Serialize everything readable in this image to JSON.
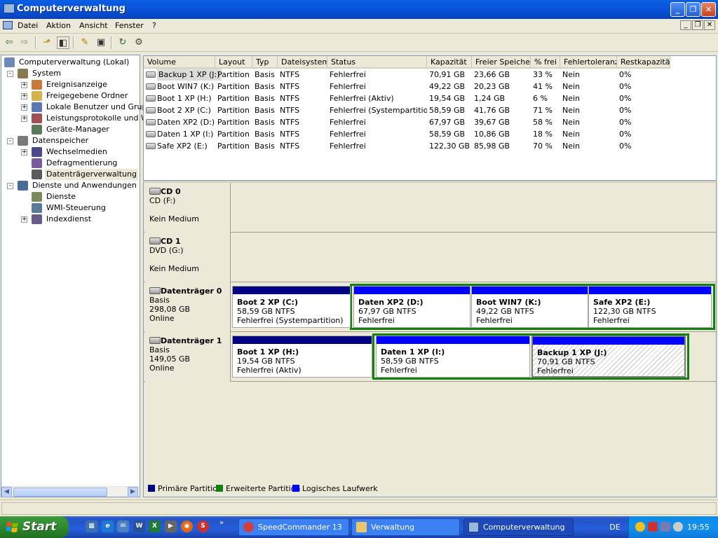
{
  "window": {
    "title": "Computerverwaltung"
  },
  "menu": [
    "Datei",
    "Aktion",
    "Ansicht",
    "Fenster",
    "?"
  ],
  "tree": [
    {
      "label": "Computerverwaltung (Lokal)",
      "level": 0,
      "expander": "",
      "icon": "computer-icon"
    },
    {
      "label": "System",
      "level": 1,
      "expander": "−",
      "icon": "tools-icon"
    },
    {
      "label": "Ereignisanzeige",
      "level": 2,
      "expander": "+",
      "icon": "event-viewer-icon"
    },
    {
      "label": "Freigegebene Ordner",
      "level": 2,
      "expander": "+",
      "icon": "shared-folder-icon"
    },
    {
      "label": "Lokale Benutzer und Gruppe",
      "level": 2,
      "expander": "+",
      "icon": "users-icon"
    },
    {
      "label": "Leistungsprotokolle und War",
      "level": 2,
      "expander": "+",
      "icon": "performance-icon"
    },
    {
      "label": "Geräte-Manager",
      "level": 2,
      "expander": "",
      "icon": "device-manager-icon"
    },
    {
      "label": "Datenspeicher",
      "level": 1,
      "expander": "−",
      "icon": "storage-icon"
    },
    {
      "label": "Wechselmedien",
      "level": 2,
      "expander": "+",
      "icon": "removable-media-icon"
    },
    {
      "label": "Defragmentierung",
      "level": 2,
      "expander": "",
      "icon": "defrag-icon"
    },
    {
      "label": "Datenträgerverwaltung",
      "level": 2,
      "expander": "",
      "icon": "disk-management-icon",
      "selected": true
    },
    {
      "label": "Dienste und Anwendungen",
      "level": 1,
      "expander": "−",
      "icon": "services-apps-icon"
    },
    {
      "label": "Dienste",
      "level": 2,
      "expander": "",
      "icon": "services-icon"
    },
    {
      "label": "WMI-Steuerung",
      "level": 2,
      "expander": "",
      "icon": "wmi-icon"
    },
    {
      "label": "Indexdienst",
      "level": 2,
      "expander": "+",
      "icon": "indexing-icon"
    }
  ],
  "volume_list": {
    "columns": [
      "Volume",
      "Layout",
      "Typ",
      "Dateisystem",
      "Status",
      "Kapazität",
      "Freier Speicher",
      "% frei",
      "Fehlertoleranz",
      "Restkapazität"
    ],
    "rows": [
      [
        "Backup 1 XP (J:)",
        "Partition",
        "Basis",
        "NTFS",
        "Fehlerfrei",
        "70,91 GB",
        "23,66 GB",
        "33 %",
        "Nein",
        "0%"
      ],
      [
        "Boot WIN7 (K:)",
        "Partition",
        "Basis",
        "NTFS",
        "Fehlerfrei",
        "49,22 GB",
        "20,23 GB",
        "41 %",
        "Nein",
        "0%"
      ],
      [
        "Boot 1 XP (H:)",
        "Partition",
        "Basis",
        "NTFS",
        "Fehlerfrei (Aktiv)",
        "19,54 GB",
        "1,24 GB",
        "6 %",
        "Nein",
        "0%"
      ],
      [
        "Boot 2 XP (C:)",
        "Partition",
        "Basis",
        "NTFS",
        "Fehlerfrei (Systempartition)",
        "58,59 GB",
        "41,76 GB",
        "71 %",
        "Nein",
        "0%"
      ],
      [
        "Daten XP2 (D:)",
        "Partition",
        "Basis",
        "NTFS",
        "Fehlerfrei",
        "67,97 GB",
        "39,67 GB",
        "58 %",
        "Nein",
        "0%"
      ],
      [
        "Daten 1 XP (I:)",
        "Partition",
        "Basis",
        "NTFS",
        "Fehlerfrei",
        "58,59 GB",
        "10,86 GB",
        "18 %",
        "Nein",
        "0%"
      ],
      [
        "Safe XP2 (E:)",
        "Partition",
        "Basis",
        "NTFS",
        "Fehlerfrei",
        "122,30 GB",
        "85,98 GB",
        "70 %",
        "Nein",
        "0%"
      ]
    ]
  },
  "disks": [
    {
      "name": "CD 0",
      "line1": "CD (F:)",
      "line3": "Kein Medium"
    },
    {
      "name": "CD 1",
      "line1": "DVD (G:)",
      "line3": "Kein Medium"
    },
    {
      "name": "Datenträger 0",
      "line1": "Basis",
      "line2": "298,08 GB",
      "line3": "Online",
      "partitions": [
        {
          "title": "Boot 2 XP  (C:)",
          "size": "58,59 GB NTFS",
          "status": "Fehlerfrei (Systempartition)",
          "kind": "primary"
        },
        {
          "title": "Daten XP2  (D:)",
          "size": "67,97 GB NTFS",
          "status": "Fehlerfrei",
          "kind": "logical"
        },
        {
          "title": "Boot WIN7  (K:)",
          "size": "49,22 GB NTFS",
          "status": "Fehlerfrei",
          "kind": "logical"
        },
        {
          "title": "Safe XP2  (E:)",
          "size": "122,30 GB NTFS",
          "status": "Fehlerfrei",
          "kind": "logical"
        }
      ]
    },
    {
      "name": "Datenträger 1",
      "line1": "Basis",
      "line2": "149,05 GB",
      "line3": "Online",
      "partitions": [
        {
          "title": "Boot 1 XP  (H:)",
          "size": "19,54 GB NTFS",
          "status": "Fehlerfrei (Aktiv)",
          "kind": "primary"
        },
        {
          "title": "Daten 1 XP  (I:)",
          "size": "58,59 GB NTFS",
          "status": "Fehlerfrei",
          "kind": "logical"
        },
        {
          "title": "Backup 1 XP  (J:)",
          "size": "70,91 GB NTFS",
          "status": "Fehlerfrei",
          "kind": "logical",
          "selected": true
        }
      ]
    }
  ],
  "legend": [
    {
      "label": "Primäre Partition",
      "color": "#000080"
    },
    {
      "label": "Erweiterte Partition",
      "color": "#148014"
    },
    {
      "label": "Logisches Laufwerk",
      "color": "#0000FF"
    }
  ],
  "taskbar": {
    "start_label": "Start",
    "tasks": [
      {
        "label": "SpeedCommander 13",
        "icon": "speedcommander-icon"
      },
      {
        "label": "Verwaltung",
        "icon": "folder-icon"
      },
      {
        "label": "Computerverwaltung",
        "icon": "computer-management-icon",
        "active": true
      }
    ],
    "language": "DE",
    "clock": "19:55"
  },
  "colors": {
    "primary": "#000080",
    "extended": "#148014",
    "logical": "#0000FF",
    "titlebar": "#0A5FE3"
  }
}
